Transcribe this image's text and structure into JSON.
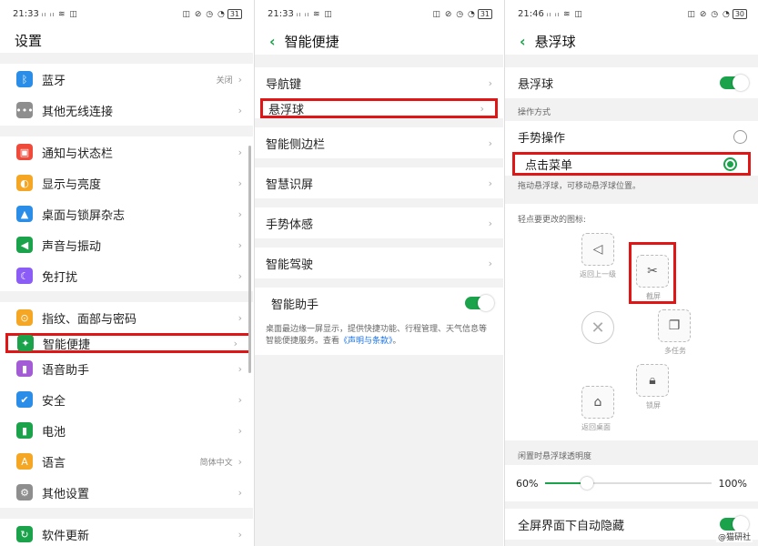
{
  "colors": {
    "accent": "#1aa34a",
    "highlight": "#e01515",
    "link": "#1a73e8"
  },
  "panel1": {
    "status": {
      "time": "21:33",
      "icons": "ᵢₗ ᵢₗ ≋ ◫",
      "right": "◫ ⊘ ◷ ◔",
      "battery": "31"
    },
    "title": "设置",
    "groups": [
      [
        {
          "label": "蓝牙",
          "value": "关闭",
          "icon": "bluetooth-icon",
          "color": "#2a8de8",
          "glyph": "ᛒ"
        },
        {
          "label": "其他无线连接",
          "value": "",
          "icon": "wireless-more-icon",
          "color": "#8e8e8e",
          "glyph": "•••"
        }
      ],
      [
        {
          "label": "通知与状态栏",
          "value": "",
          "icon": "notification-icon",
          "color": "#f04a3a",
          "glyph": "▣"
        },
        {
          "label": "显示与亮度",
          "value": "",
          "icon": "brightness-icon",
          "color": "#f5a623",
          "glyph": "◐"
        },
        {
          "label": "桌面与锁屏杂志",
          "value": "",
          "icon": "wallpaper-icon",
          "color": "#2a8de8",
          "glyph": "▲"
        },
        {
          "label": "声音与振动",
          "value": "",
          "icon": "sound-icon",
          "color": "#1aa34a",
          "glyph": "◀"
        },
        {
          "label": "免打扰",
          "value": "",
          "icon": "moon-icon",
          "color": "#8b5cf6",
          "glyph": "☾"
        }
      ],
      [
        {
          "label": "指纹、面部与密码",
          "value": "",
          "icon": "fingerprint-icon",
          "color": "#f5a623",
          "glyph": "⊙"
        },
        {
          "label": "智能便捷",
          "value": "",
          "icon": "smart-icon",
          "color": "#1aa34a",
          "glyph": "✦",
          "highlight": true
        },
        {
          "label": "语音助手",
          "value": "",
          "icon": "mic-icon",
          "color": "#a35bd6",
          "glyph": "▮"
        },
        {
          "label": "安全",
          "value": "",
          "icon": "shield-icon",
          "color": "#2a8de8",
          "glyph": "✔"
        },
        {
          "label": "电池",
          "value": "",
          "icon": "battery-icon",
          "color": "#1aa34a",
          "glyph": "▮"
        },
        {
          "label": "语言",
          "value": "简体中文",
          "icon": "language-icon",
          "color": "#f5a623",
          "glyph": "A"
        },
        {
          "label": "其他设置",
          "value": "",
          "icon": "gear-icon",
          "color": "#8e8e8e",
          "glyph": "⚙"
        }
      ],
      [
        {
          "label": "软件更新",
          "value": "",
          "icon": "update-icon",
          "color": "#1aa34a",
          "glyph": "↻"
        }
      ]
    ]
  },
  "panel2": {
    "status": {
      "time": "21:33",
      "icons": "ᵢₗ ᵢₗ ≋ ◫",
      "right": "◫ ⊘ ◷ ◔",
      "battery": "31"
    },
    "title": "智能便捷",
    "groups": [
      [
        {
          "label": "导航键"
        },
        {
          "label": "悬浮球",
          "highlight": true
        }
      ],
      [
        {
          "label": "智能侧边栏"
        }
      ],
      [
        {
          "label": "智慧识屏"
        }
      ],
      [
        {
          "label": "手势体感"
        }
      ],
      [
        {
          "label": "智能驾驶"
        }
      ]
    ],
    "assistant": {
      "label": "智能助手"
    },
    "desc_text": "桌面最边缘一屏显示，提供快捷功能、行程管理、天气信息等智能便捷服务。查看",
    "desc_link": "《声明与条款》",
    "desc_end": "。"
  },
  "panel3": {
    "status": {
      "time": "21:46",
      "icons": "ᵢₗ ᵢₗ ≋ ◫",
      "right": "◫ ⊘ ◷ ◔",
      "battery": "30"
    },
    "title": "悬浮球",
    "toggle_label": "悬浮球",
    "section_mode": "操作方式",
    "gesture_label": "手势操作",
    "tap_label": "点击菜单",
    "drag_desc": "拖动悬浮球，可移动悬浮球位置。",
    "icons_title": "轻点要更改的图标:",
    "icons": {
      "back": {
        "glyph": "◁",
        "caption": "返回上一级"
      },
      "screenshot": {
        "glyph": "✂",
        "caption": "截屏"
      },
      "multitask": {
        "glyph": "❐",
        "caption": "多任务"
      },
      "lock": {
        "glyph": "🔒︎",
        "caption": "锁屏"
      },
      "home": {
        "glyph": "⌂",
        "caption": "返回桌面"
      },
      "center": {
        "glyph": "✕"
      }
    },
    "opacity_title": "闲置时悬浮球透明度",
    "opacity_min": "60%",
    "opacity_max": "100%",
    "opacity_level": 0.25,
    "bottom_label": "全屏界面下自动隐藏"
  },
  "watermark": "@猫研社"
}
